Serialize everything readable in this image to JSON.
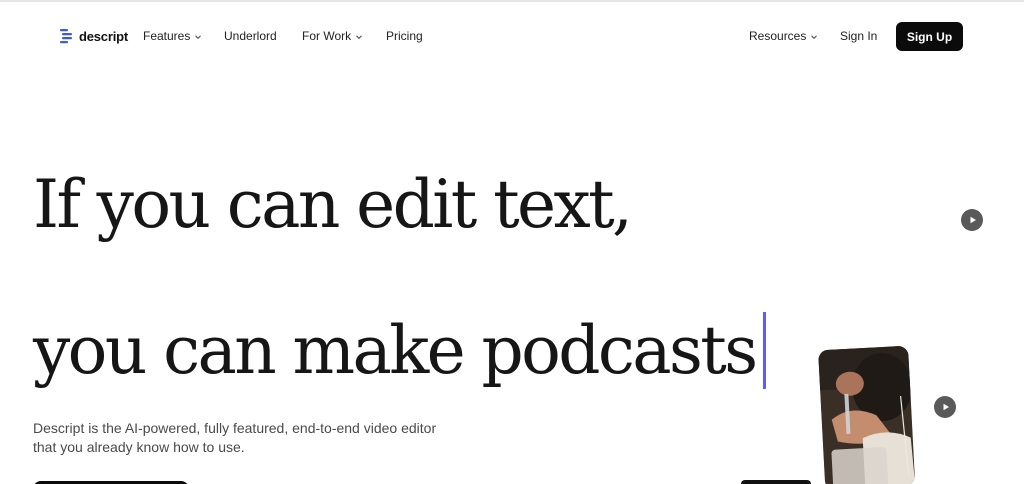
{
  "brand": {
    "name": "descript",
    "color": "#3b5bdb"
  },
  "nav": {
    "items": [
      {
        "label": "Features",
        "has_dropdown": true
      },
      {
        "label": "Underlord",
        "has_dropdown": false
      },
      {
        "label": "For Work",
        "has_dropdown": true
      },
      {
        "label": "Pricing",
        "has_dropdown": false
      }
    ],
    "resources_label": "Resources",
    "signin_label": "Sign In",
    "signup_label": "Sign Up"
  },
  "hero": {
    "line1": "If you can edit text,",
    "line2": "you can make podcasts",
    "caret_color": "#5a5ff0",
    "subcopy_line1": "Descript is the AI-powered, fully featured, end-to-end video editor",
    "subcopy_line2": "that you already know how to use."
  },
  "icons": {
    "logo": "descript-logo-icon",
    "dropdown": "chevron-down-icon",
    "play": "play-icon"
  }
}
